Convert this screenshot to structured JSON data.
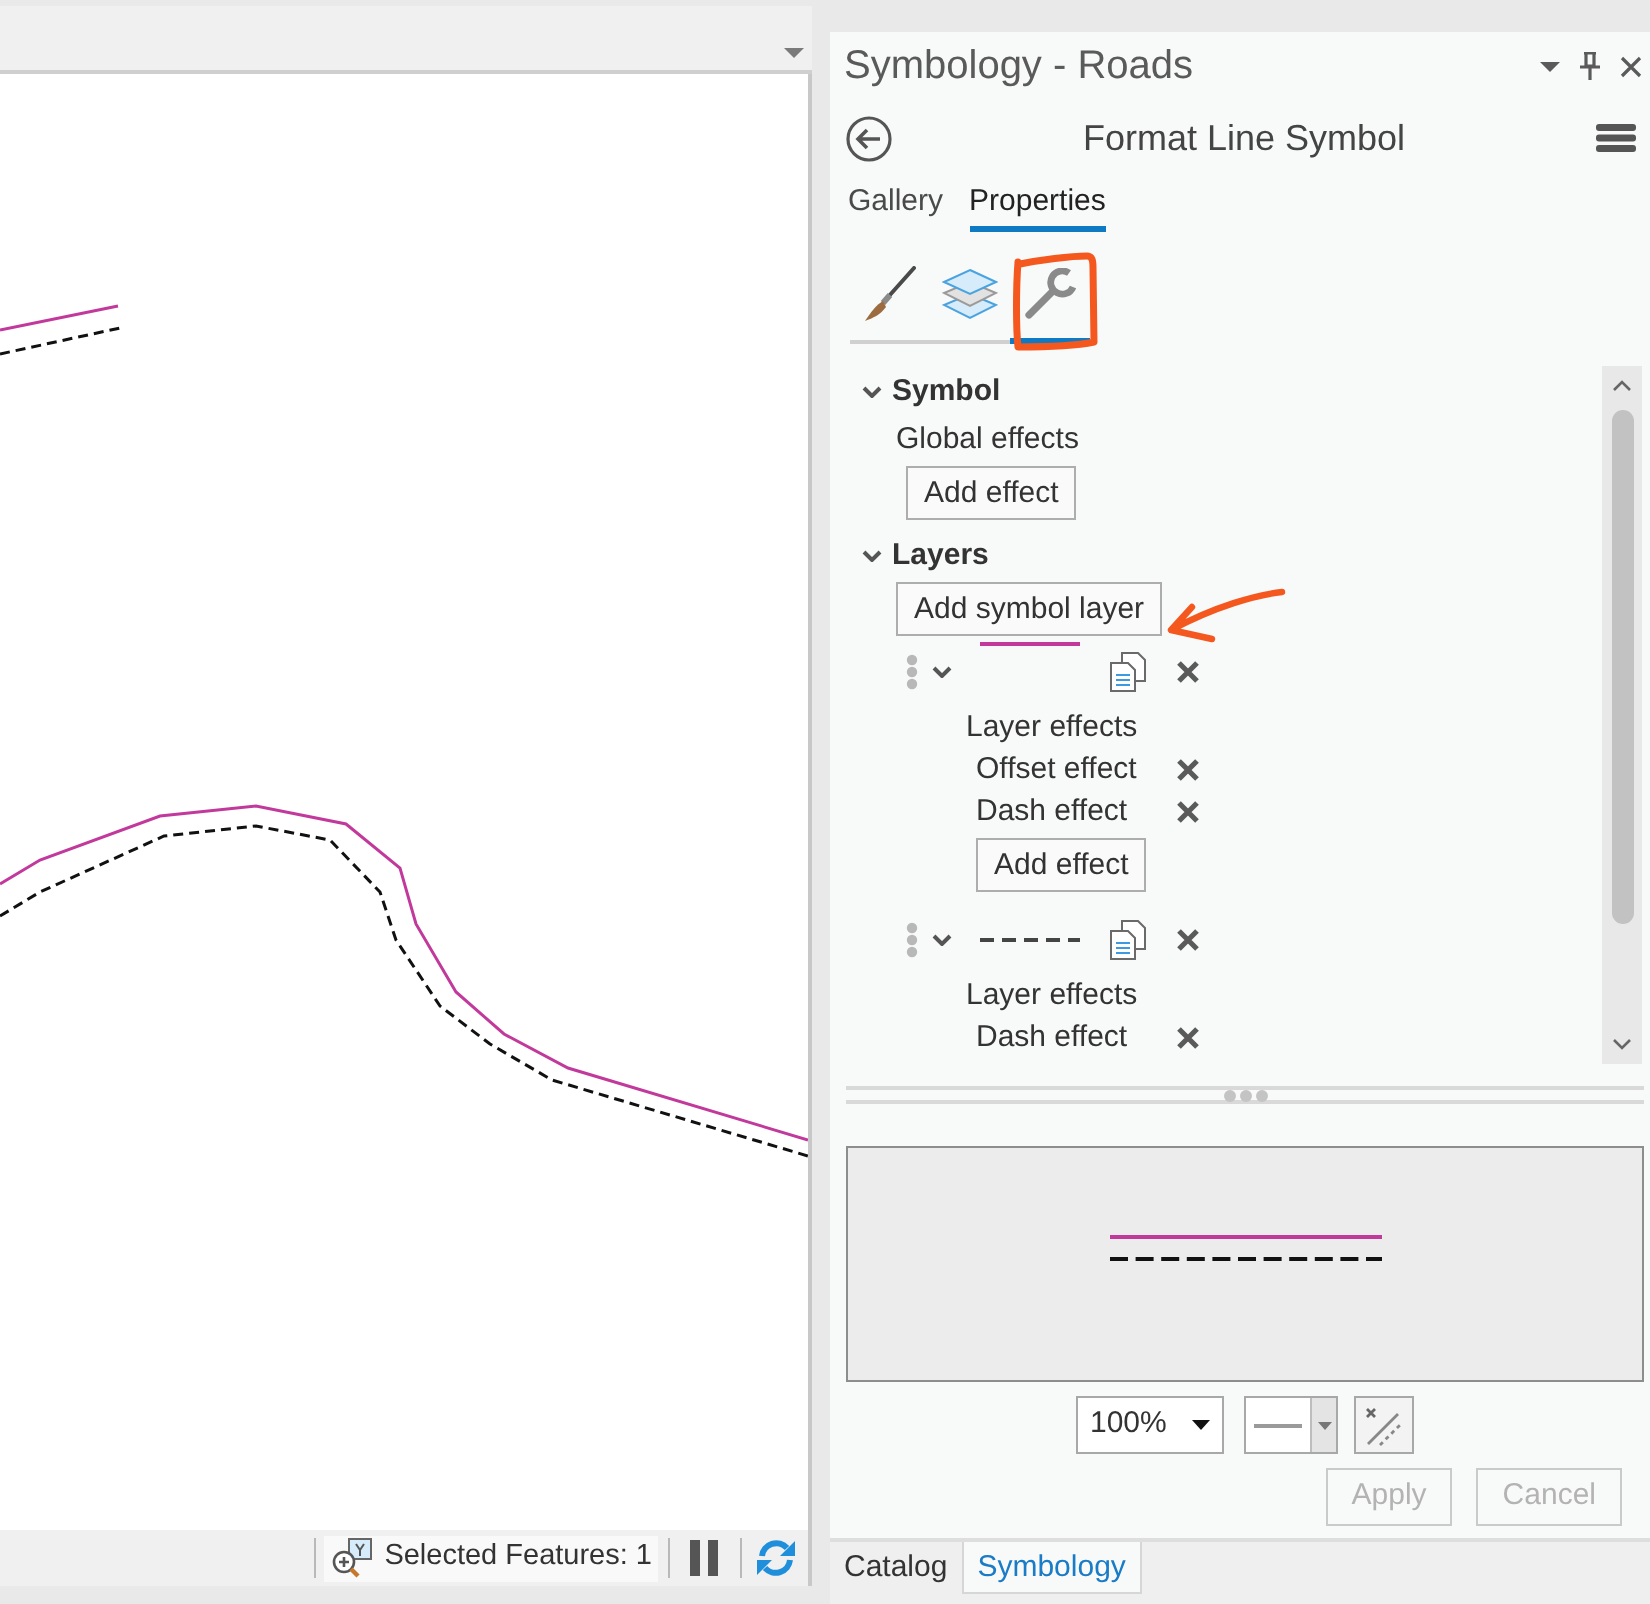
{
  "status_bar": {
    "selection_text": "Selected Features: 1"
  },
  "pane": {
    "title": "Symbology - Roads",
    "heading": "Format Line Symbol",
    "tabs": [
      {
        "label": "Gallery",
        "selected": false
      },
      {
        "label": "Properties",
        "selected": true
      }
    ],
    "property_tabs": [
      {
        "kind": "brush",
        "selected": false
      },
      {
        "kind": "layers",
        "selected": false
      },
      {
        "kind": "wrench",
        "selected": true
      }
    ],
    "symbol_section": {
      "title": "Symbol",
      "expanded": true,
      "effects_label": "Global effects",
      "add_button": "Add effect"
    },
    "layers_section": {
      "title": "Layers",
      "expanded": true,
      "add_button": "Add symbol layer",
      "layers": [
        {
          "kind": "solid",
          "color": "#c2399c",
          "expanded": true,
          "effects_label": "Layer effects",
          "effects": [
            "Offset effect",
            "Dash effect"
          ],
          "add_button": "Add effect"
        },
        {
          "kind": "dashed",
          "color": "#444444",
          "expanded": true,
          "effects_label": "Layer effects",
          "effects": [
            "Dash effect"
          ]
        }
      ]
    },
    "preview_zoom": "100%",
    "buttons": [
      {
        "label": "Apply",
        "disabled": true
      },
      {
        "label": "Cancel",
        "disabled": true
      }
    ]
  },
  "bottom_tabs": [
    {
      "label": "Catalog",
      "selected": false
    },
    {
      "label": "Symbology",
      "selected": true
    }
  ]
}
